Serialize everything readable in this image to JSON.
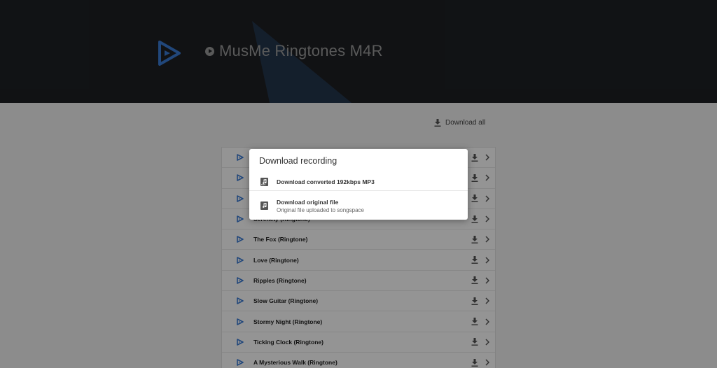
{
  "header": {
    "title": "MusMe Ringtones M4R"
  },
  "toolbar": {
    "download_all_label": "Download all"
  },
  "tracks": [
    {
      "title": ""
    },
    {
      "title": ""
    },
    {
      "title": ""
    },
    {
      "title": "Serenety (Ringtone)"
    },
    {
      "title": "The Fox (Ringtone)"
    },
    {
      "title": "Love (Ringtone)"
    },
    {
      "title": "Ripples (Ringtone)"
    },
    {
      "title": "Slow Guitar (Ringtone)"
    },
    {
      "title": "Stormy Night (Ringtone)"
    },
    {
      "title": "Ticking Clock (Ringtone)"
    },
    {
      "title": "A Mysterious Walk (Ringtone)"
    }
  ],
  "modal": {
    "title": "Download recording",
    "options": [
      {
        "primary": "Download converted 192kbps MP3",
        "secondary": "",
        "icon": "mp3-file-icon",
        "badge": "MP3"
      },
      {
        "primary": "Download original file",
        "secondary": "Original file uploaded to songspace",
        "icon": "music-file-icon"
      }
    ]
  },
  "colors": {
    "header_bg": "#1e2024",
    "brand_blue": "#3a7bd5",
    "overlay": "rgba(0,0,0,0.42)",
    "modal_bg": "#ffffff"
  }
}
